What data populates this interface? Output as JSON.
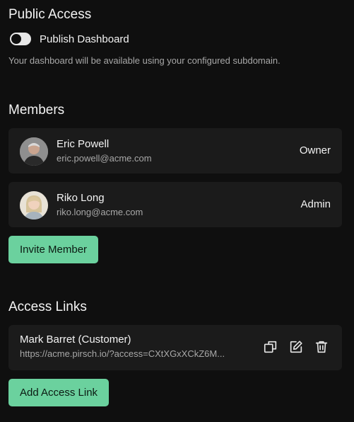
{
  "public_access": {
    "title": "Public Access",
    "toggle_label": "Publish Dashboard",
    "toggle_on": false,
    "hint": "Your dashboard will be available using your configured subdomain."
  },
  "members": {
    "title": "Members",
    "items": [
      {
        "name": "Eric Powell",
        "email": "eric.powell@acme.com",
        "role": "Owner"
      },
      {
        "name": "Riko Long",
        "email": "riko.long@acme.com",
        "role": "Admin"
      }
    ],
    "invite_label": "Invite Member"
  },
  "access_links": {
    "title": "Access Links",
    "items": [
      {
        "name": "Mark Barret (Customer)",
        "url": "https://acme.pirsch.io/?access=CXtXGxXCkZ6M..."
      }
    ],
    "add_label": "Add Access Link"
  },
  "colors": {
    "background": "#0f0f0f",
    "card": "#1b1b1b",
    "accent": "#6bd19e",
    "muted_text": "#a8a8a8"
  },
  "icons": [
    "copy-icon",
    "edit-icon",
    "trash-icon"
  ]
}
